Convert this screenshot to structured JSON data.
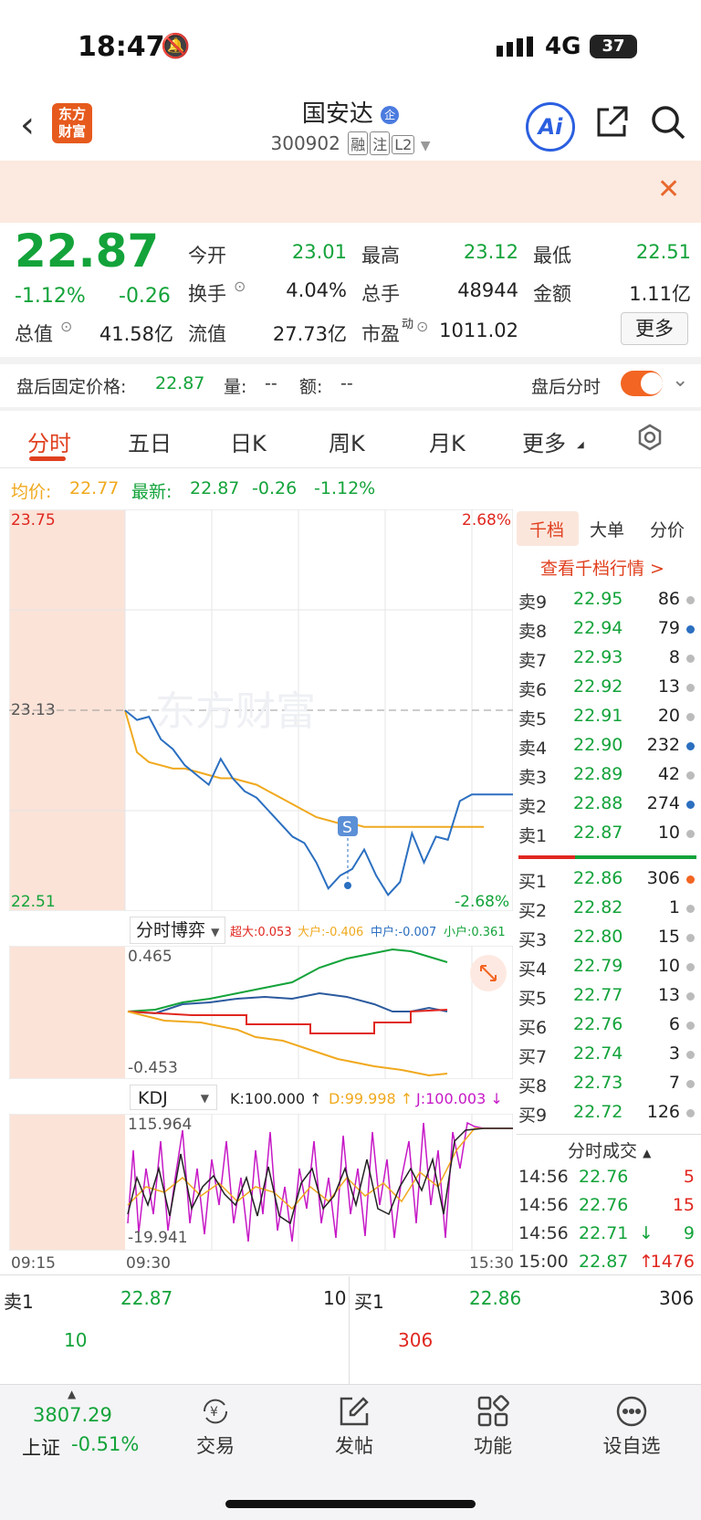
{
  "status_bar": {
    "time": "18:47",
    "network": "4G",
    "battery": "37"
  },
  "header": {
    "logo_text": "东方财富",
    "stock_name": "国安达",
    "stock_code": "300902",
    "tags": [
      "融",
      "注",
      "L2"
    ]
  },
  "quote": {
    "price": "22.87",
    "change_pct": "-1.12%",
    "change": "-0.26",
    "open_label": "今开",
    "open": "23.01",
    "high_label": "最高",
    "high": "23.12",
    "low_label": "最低",
    "low": "22.51",
    "turnover_label": "换手",
    "turnover": "4.04%",
    "volume_label": "总手",
    "volume": "48944",
    "amount_label": "金额",
    "amount": "1.11亿",
    "mktcap_label": "总值",
    "mktcap": "41.58亿",
    "float_label": "流值",
    "float": "27.73亿",
    "pe_label": "市盈",
    "pe_sup": "动",
    "pe": "1011.02",
    "more": "更多"
  },
  "after_hours": {
    "label": "盘后固定价格:",
    "price": "22.87",
    "vol_label": "量:",
    "vol": "--",
    "amt_label": "额:",
    "amt": "--",
    "ah_label": "盘后分时"
  },
  "tabs": [
    "分时",
    "五日",
    "日K",
    "周K",
    "月K",
    "更多"
  ],
  "chart_info": {
    "avg_label": "均价:",
    "avg": "22.77",
    "latest_label": "最新:",
    "latest": "22.87",
    "chg": "-0.26",
    "chg_pct": "-1.12%"
  },
  "chart_data": {
    "type": "line",
    "y_labels": {
      "top": "23.75",
      "mid": "23.13",
      "bottom": "22.51",
      "top_pct": "2.68%",
      "bottom_pct": "-2.68%"
    },
    "x_labels": [
      "09:15",
      "09:30",
      "15:30"
    ],
    "ylim": [
      22.51,
      23.75
    ],
    "series": [
      {
        "color": "#2b6fc0",
        "values": [
          23.13,
          23.1,
          23.11,
          23.04,
          23.01,
          22.96,
          22.93,
          22.9,
          22.98,
          22.92,
          22.88,
          22.86,
          22.82,
          22.78,
          22.74,
          22.72,
          22.66,
          22.58,
          22.62,
          22.64,
          22.7,
          22.62,
          22.56,
          22.6,
          22.75,
          22.66,
          22.74,
          22.73,
          22.85,
          22.87,
          22.87
        ]
      },
      {
        "color": "#f0a91e",
        "values": [
          23.13,
          23.0,
          22.97,
          22.96,
          22.95,
          22.95,
          22.94,
          22.93,
          22.92,
          22.92,
          22.91,
          22.9,
          22.88,
          22.86,
          22.84,
          22.82,
          22.8,
          22.79,
          22.78,
          22.78,
          22.77,
          22.77,
          22.77,
          22.77,
          22.77,
          22.77,
          22.77,
          22.77,
          22.77,
          22.77,
          22.77
        ]
      }
    ],
    "flow_panel": {
      "label": "分时博弈",
      "super": "超大:0.053",
      "large": "大户:-0.406",
      "mid": "中户:-0.007",
      "small": "小户:0.361",
      "top": "0.465",
      "bottom": "-0.453"
    },
    "kdj_panel": {
      "label": "KDJ",
      "k": "K:100.000 ↑",
      "d": "D:99.998 ↑",
      "j": "J:100.003 ↓",
      "top": "115.964",
      "bottom": "-19.941"
    }
  },
  "orderbook": {
    "tabs": [
      "千档",
      "大单",
      "分价"
    ],
    "link": "查看千档行情 >",
    "asks": [
      {
        "label": "卖9",
        "price": "22.95",
        "vol": "86",
        "dot": "#bbb"
      },
      {
        "label": "卖8",
        "price": "22.94",
        "vol": "79",
        "dot": "#2b6fc0"
      },
      {
        "label": "卖7",
        "price": "22.93",
        "vol": "8",
        "dot": "#bbb"
      },
      {
        "label": "卖6",
        "price": "22.92",
        "vol": "13",
        "dot": "#bbb"
      },
      {
        "label": "卖5",
        "price": "22.91",
        "vol": "20",
        "dot": "#bbb"
      },
      {
        "label": "卖4",
        "price": "22.90",
        "vol": "232",
        "dot": "#2b6fc0"
      },
      {
        "label": "卖3",
        "price": "22.89",
        "vol": "42",
        "dot": "#bbb"
      },
      {
        "label": "卖2",
        "price": "22.88",
        "vol": "274",
        "dot": "#2b6fc0"
      },
      {
        "label": "卖1",
        "price": "22.87",
        "vol": "10",
        "dot": "#bbb"
      }
    ],
    "bids": [
      {
        "label": "买1",
        "price": "22.86",
        "vol": "306",
        "dot": "#f26522"
      },
      {
        "label": "买2",
        "price": "22.82",
        "vol": "1",
        "dot": "#bbb"
      },
      {
        "label": "买3",
        "price": "22.80",
        "vol": "15",
        "dot": "#bbb"
      },
      {
        "label": "买4",
        "price": "22.79",
        "vol": "10",
        "dot": "#bbb"
      },
      {
        "label": "买5",
        "price": "22.77",
        "vol": "13",
        "dot": "#bbb"
      },
      {
        "label": "买6",
        "price": "22.76",
        "vol": "6",
        "dot": "#bbb"
      },
      {
        "label": "买7",
        "price": "22.74",
        "vol": "3",
        "dot": "#bbb"
      },
      {
        "label": "买8",
        "price": "22.73",
        "vol": "7",
        "dot": "#bbb"
      },
      {
        "label": "买9",
        "price": "22.72",
        "vol": "126",
        "dot": "#bbb"
      }
    ],
    "trades_title": "分时成交",
    "trades": [
      {
        "time": "14:56",
        "price": "22.76",
        "vol": "5",
        "arrow": ""
      },
      {
        "time": "14:56",
        "price": "22.76",
        "vol": "15",
        "arrow": ""
      },
      {
        "time": "14:56",
        "price": "22.71",
        "vol": "9",
        "arrow": "↓"
      },
      {
        "time": "15:00",
        "price": "22.87",
        "vol": "1476",
        "arrow": "↑"
      }
    ]
  },
  "bottom_quote": {
    "ask_label": "卖1",
    "ask_price": "22.87",
    "ask_vol": "10",
    "bid_label": "买1",
    "bid_price": "22.86",
    "bid_vol": "306",
    "ask_vol2": "10",
    "bid_vol2": "306"
  },
  "bottom_nav": {
    "index_value": "3807.29",
    "index_name": "上证",
    "index_change": "-0.51%",
    "items": [
      "交易",
      "发帖",
      "功能",
      "设自选"
    ]
  }
}
